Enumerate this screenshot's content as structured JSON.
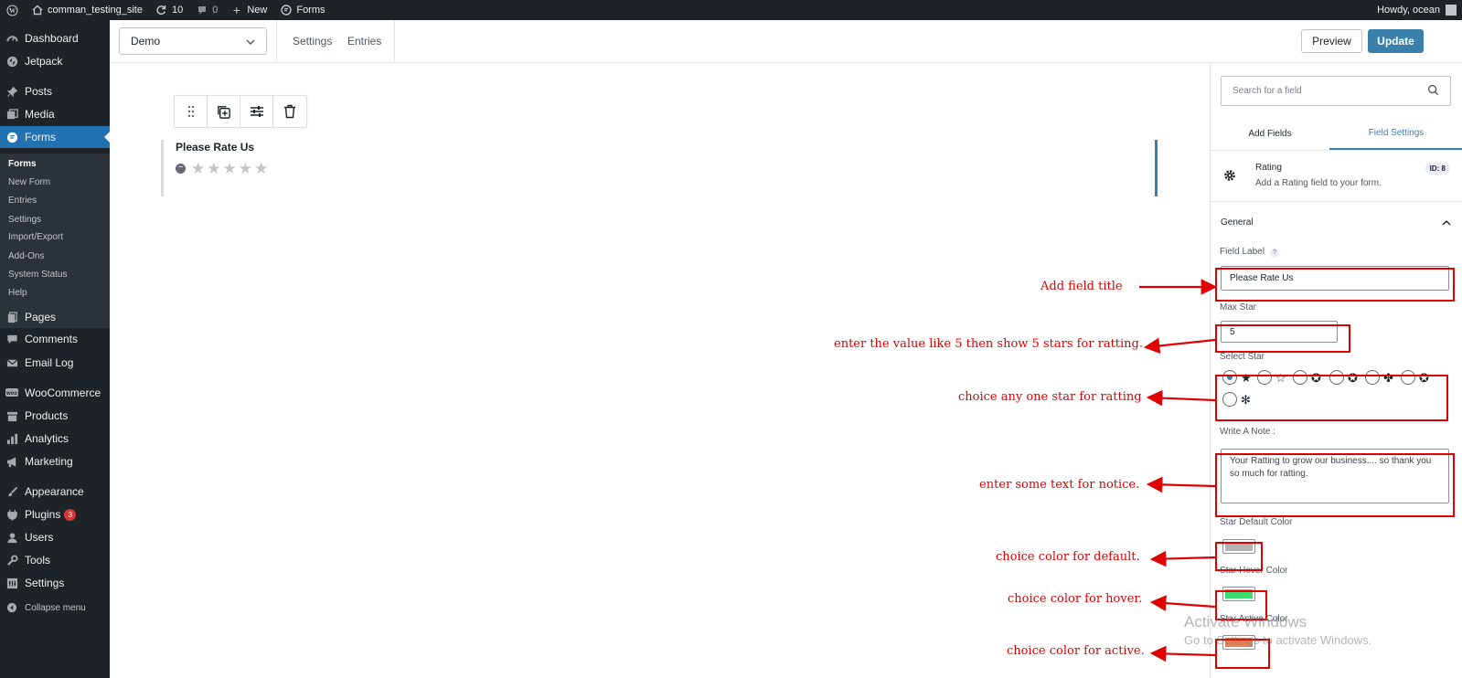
{
  "adminbar": {
    "site_name": "comman_testing_site",
    "updates_count": "10",
    "comments_count": "0",
    "new_label": "New",
    "forms_label": "Forms",
    "howdy": "Howdy, ocean"
  },
  "sidebar": {
    "items": [
      {
        "label": "Dashboard",
        "icon": "dashboard-icon"
      },
      {
        "label": "Jetpack",
        "icon": "jetpack-icon"
      },
      {
        "label": "Posts",
        "icon": "pin-icon"
      },
      {
        "label": "Media",
        "icon": "media-icon"
      },
      {
        "label": "Forms",
        "icon": "forms-icon"
      },
      {
        "label": "Pages",
        "icon": "page-icon"
      },
      {
        "label": "Comments",
        "icon": "comment-icon"
      },
      {
        "label": "Email Log",
        "icon": "email-icon"
      },
      {
        "label": "WooCommerce",
        "icon": "woo-icon"
      },
      {
        "label": "Products",
        "icon": "archive-icon"
      },
      {
        "label": "Analytics",
        "icon": "chart-icon"
      },
      {
        "label": "Marketing",
        "icon": "megaphone-icon"
      },
      {
        "label": "Appearance",
        "icon": "brush-icon"
      },
      {
        "label": "Plugins",
        "icon": "plugin-icon",
        "badge": "3"
      },
      {
        "label": "Users",
        "icon": "user-icon"
      },
      {
        "label": "Tools",
        "icon": "wrench-icon"
      },
      {
        "label": "Settings",
        "icon": "settings-icon"
      },
      {
        "label": "Collapse menu",
        "icon": "collapse-icon"
      }
    ],
    "submenu": [
      "Forms",
      "New Form",
      "Entries",
      "Settings",
      "Import/Export",
      "Add-Ons",
      "System Status",
      "Help"
    ]
  },
  "header": {
    "form_select_value": "Demo",
    "settings_link": "Settings",
    "entries_link": "Entries",
    "preview_label": "Preview",
    "update_label": "Update"
  },
  "canvas": {
    "field_label": "Please Rate Us",
    "star_count": 5,
    "star_glyph": "★"
  },
  "panel": {
    "search_placeholder": "Search for a field",
    "tab_add": "Add Fields",
    "tab_settings": "Field Settings",
    "field_type": "Rating",
    "field_desc": "Add a Rating field to your form.",
    "field_id": "ID: 8",
    "general_label": "General",
    "field_label_title": "Field Label",
    "help_mark": "?",
    "field_label_value": "Please Rate Us",
    "max_star_title": "Max Star",
    "max_star_value": "5",
    "select_star_title": "Select Star",
    "star_options": [
      "★",
      "☆",
      "✪",
      "✪",
      "✤",
      "✪",
      "✻"
    ],
    "note_title": "Write A Note :",
    "note_value": "Your Ratting to grow our business.... so thank you so much for ratting.",
    "default_color_title": "Star Default Color",
    "default_color": "#b3b3b3",
    "hover_color_title": "Star Hover Color",
    "hover_color": "#3ddc6f",
    "active_color_title": "Star Active Color",
    "active_color": "#f08050"
  },
  "annotations": {
    "field_title": "Add field title",
    "max_star": "enter the value like 5 then show 5 stars for ratting.",
    "select_star": "choice any one star for ratting",
    "note": "enter some text for notice.",
    "default_color": "choice color for default.",
    "hover_color": "choice color for hover.",
    "active_color": "choice color for active."
  },
  "watermark": {
    "line1": "Activate Windows",
    "line2": "Go to Settings to activate Windows."
  }
}
